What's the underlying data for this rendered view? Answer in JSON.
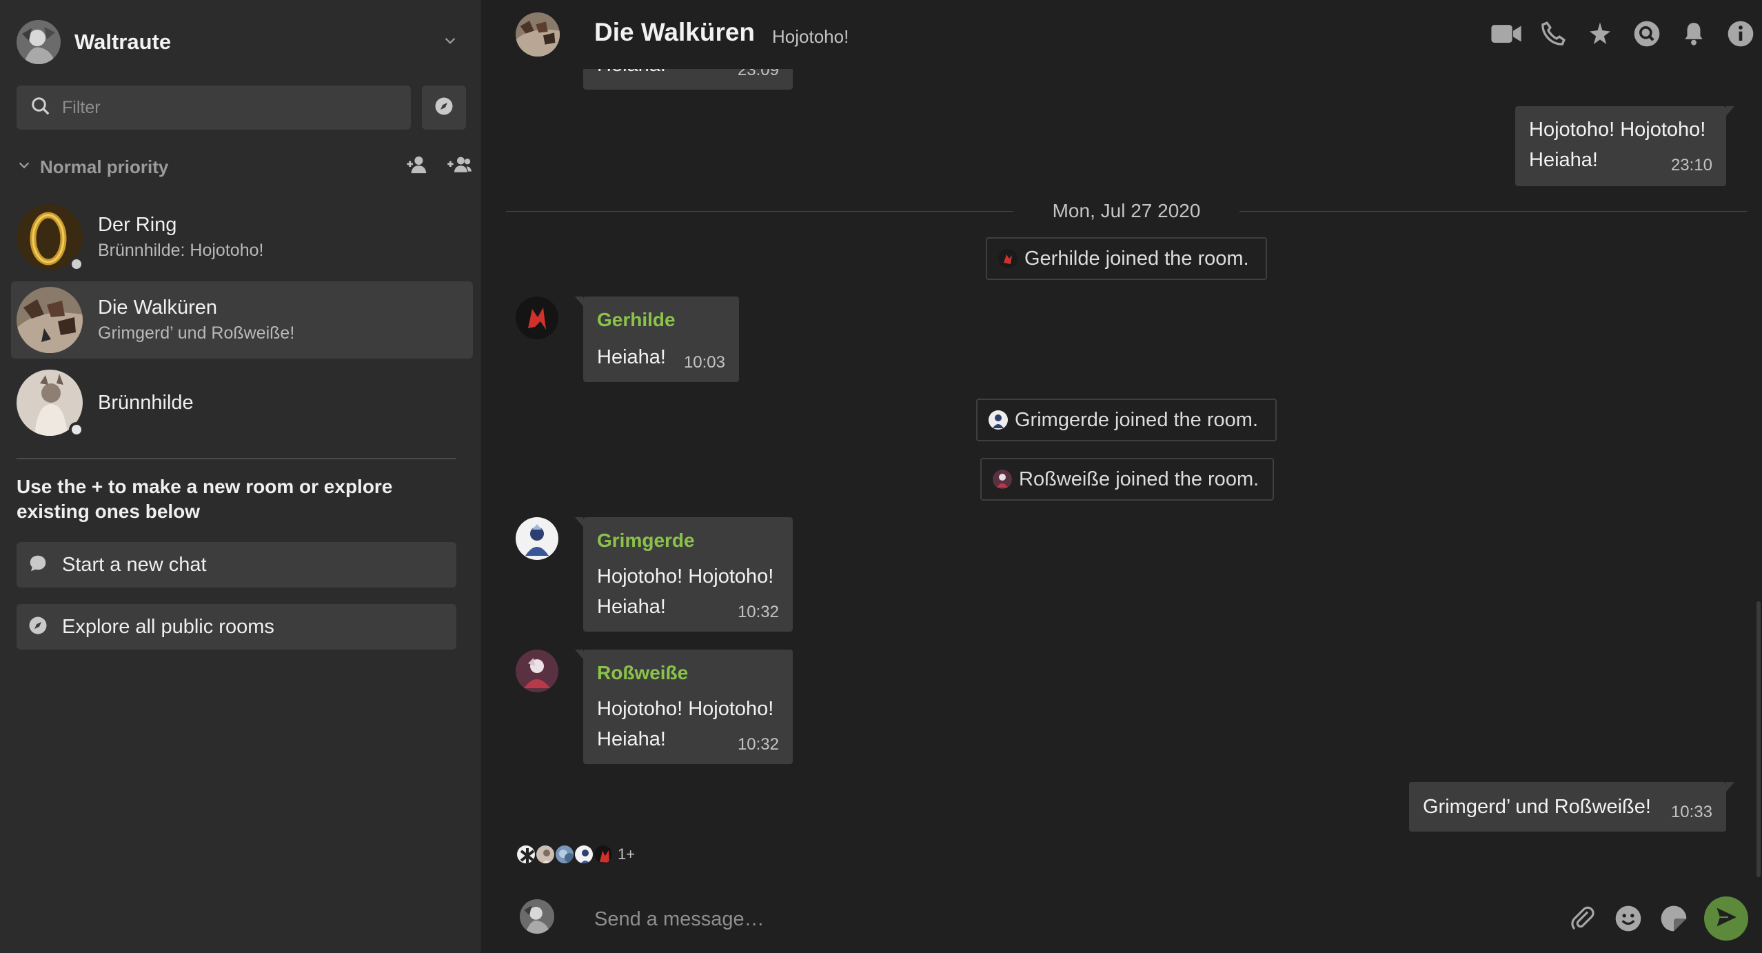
{
  "user": {
    "name": "Waltraute"
  },
  "sidebar": {
    "filter_placeholder": "Filter",
    "section_title": "Normal priority",
    "rooms": [
      {
        "name": "Der Ring",
        "preview": "Brünnhilde: Hojotoho!"
      },
      {
        "name": "Die Walküren",
        "preview": "Grimgerd’ und Roßweiße!"
      },
      {
        "name": "Brünnhilde",
        "preview": ""
      }
    ],
    "hint": "Use the + to make a new room or explore existing ones below",
    "start_chat_label": "Start a new chat",
    "explore_label": "Explore all public rooms"
  },
  "room": {
    "title": "Die Walküren",
    "topic": "Hojotoho!"
  },
  "timeline": {
    "partial_top": {
      "body": "Heiaha!",
      "time": "23:09"
    },
    "own_1": {
      "line1": "Hojotoho! Hojotoho!",
      "line2": "Heiaha!",
      "time": "23:10"
    },
    "date_separator": "Mon, Jul 27 2020",
    "notice_gerhilde": "Gerhilde joined the room.",
    "msg_gerhilde": {
      "sender": "Gerhilde",
      "body": "Heiaha!",
      "time": "10:03"
    },
    "notice_grimgerde": "Grimgerde joined the room.",
    "notice_rossweisse": "Roßweiße joined the room.",
    "msg_grimgerde": {
      "sender": "Grimgerde",
      "line1": "Hojotoho! Hojotoho!",
      "line2": "Heiaha!",
      "time": "10:32"
    },
    "msg_rossweisse": {
      "sender": "Roßweiße",
      "line1": "Hojotoho! Hojotoho!",
      "line2": "Heiaha!",
      "time": "10:32"
    },
    "own_2": {
      "body": "Grimgerd’ und Roßweiße!",
      "time": "10:33"
    },
    "read_receipts_more": "1+"
  },
  "composer": {
    "placeholder": "Send a message…"
  },
  "colors": {
    "sender": "#8bc34a",
    "send_button": "#5c8a3a",
    "bubble": "#3d3d3d"
  }
}
